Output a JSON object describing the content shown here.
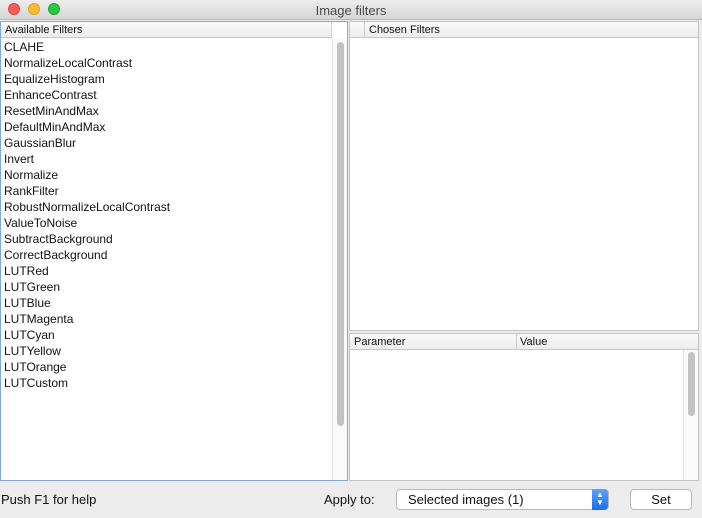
{
  "window": {
    "title": "Image filters"
  },
  "available": {
    "header": "Available Filters",
    "items": [
      "CLAHE",
      "NormalizeLocalContrast",
      "EqualizeHistogram",
      "EnhanceContrast",
      "ResetMinAndMax",
      "DefaultMinAndMax",
      "GaussianBlur",
      "Invert",
      "Normalize",
      "RankFilter",
      "RobustNormalizeLocalContrast",
      "ValueToNoise",
      "SubtractBackground",
      "CorrectBackground",
      "LUTRed",
      "LUTGreen",
      "LUTBlue",
      "LUTMagenta",
      "LUTCyan",
      "LUTYellow",
      "LUTOrange",
      "LUTCustom"
    ]
  },
  "chosen": {
    "header": "Chosen Filters"
  },
  "params": {
    "col_parameter": "Parameter",
    "col_value": "Value"
  },
  "footer": {
    "help": "Push F1 for help",
    "apply_label": "Apply to:",
    "apply_value": "Selected images (1)",
    "set_label": "Set"
  }
}
